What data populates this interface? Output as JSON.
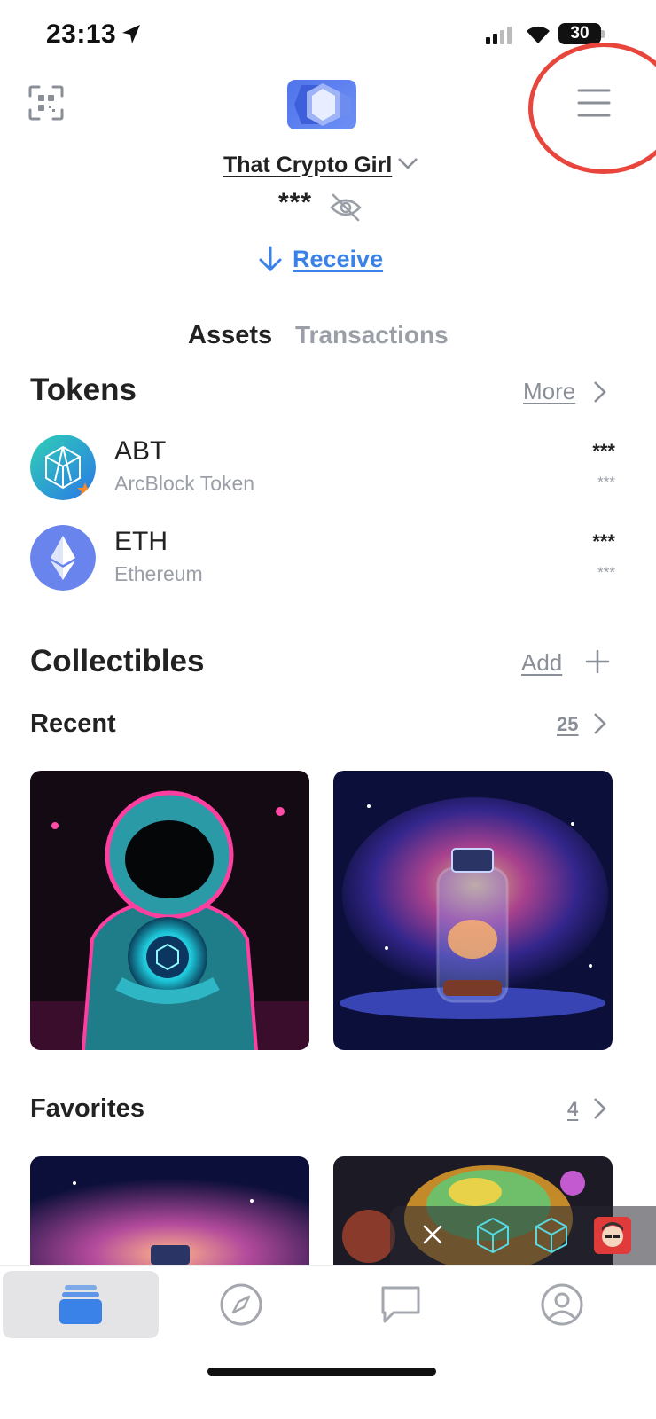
{
  "status_bar": {
    "time": "23:13",
    "battery": "30"
  },
  "header": {
    "account_name": "That Crypto Girl",
    "balance_masked": "***",
    "receive_label": "Receive"
  },
  "tabs": [
    {
      "label": "Assets",
      "active": true
    },
    {
      "label": "Transactions",
      "active": false
    }
  ],
  "tokens": {
    "title": "Tokens",
    "more_label": "More",
    "items": [
      {
        "symbol": "ABT",
        "name": "ArcBlock Token",
        "amount": "***",
        "fiat": "***",
        "icon": "arcblock-icon"
      },
      {
        "symbol": "ETH",
        "name": "Ethereum",
        "amount": "***",
        "fiat": "***",
        "icon": "ethereum-icon"
      }
    ]
  },
  "collectibles": {
    "title": "Collectibles",
    "add_label": "Add",
    "recent": {
      "title": "Recent",
      "count": "25"
    },
    "favorites": {
      "title": "Favorites",
      "count": "4"
    }
  },
  "bottom_nav": [
    {
      "name": "wallet-tab",
      "icon": "wallet-stack-icon",
      "active": true
    },
    {
      "name": "explore-tab",
      "icon": "compass-icon",
      "active": false
    },
    {
      "name": "messages-tab",
      "icon": "chat-icon",
      "active": false
    },
    {
      "name": "profile-tab",
      "icon": "user-icon",
      "active": false
    }
  ],
  "colors": {
    "accent": "#3b82e8",
    "highlight_circle": "#e8453c",
    "muted_text": "#9a9ea6"
  }
}
